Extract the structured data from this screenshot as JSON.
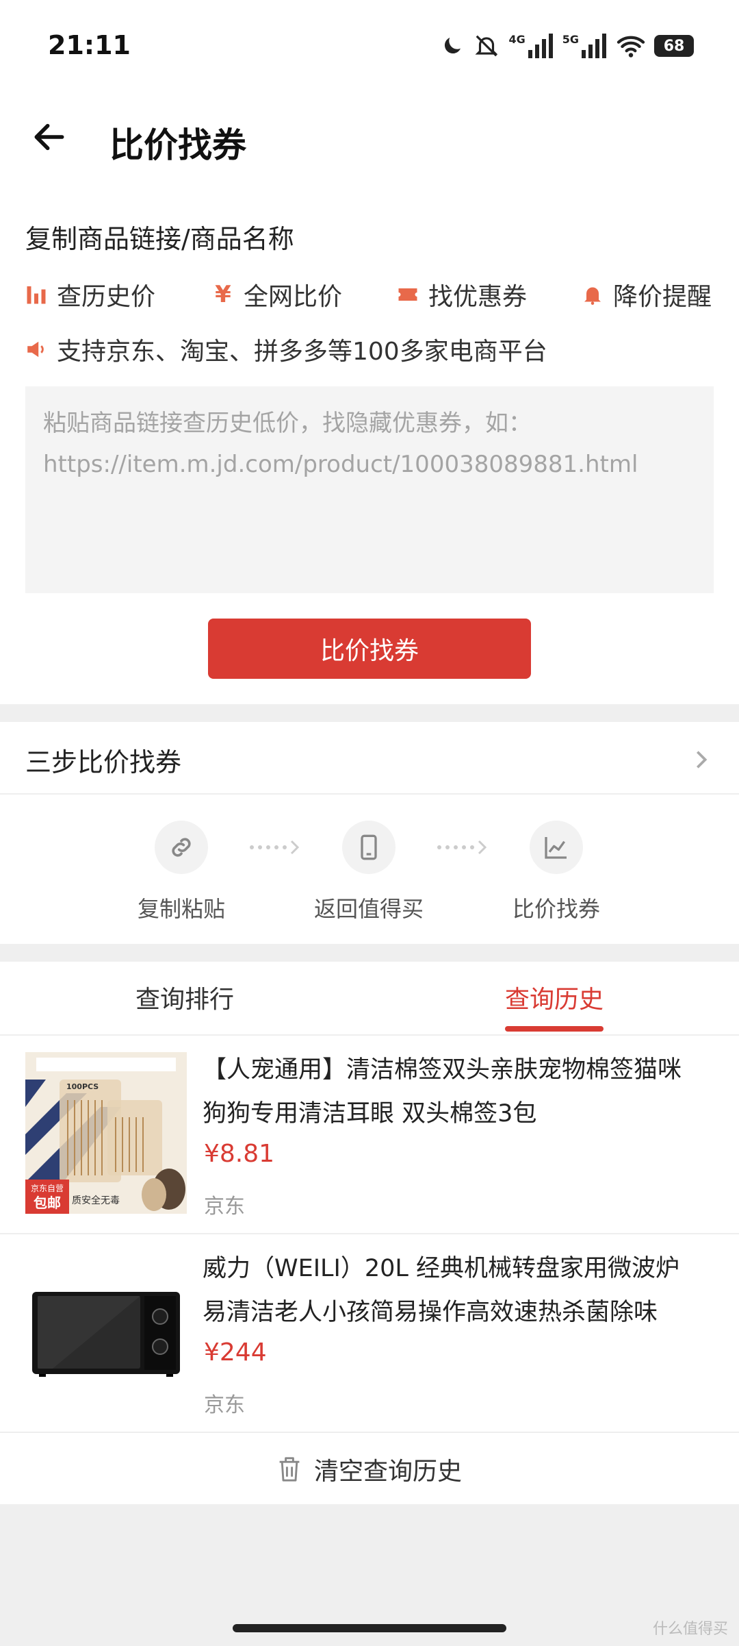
{
  "status_bar": {
    "time": "21:11",
    "battery": "68",
    "net1": "4G",
    "net2": "5G"
  },
  "header": {
    "title": "比价找券",
    "back_icon": "back-arrow-icon"
  },
  "form": {
    "label": "复制商品链接/商品名称",
    "features": [
      {
        "icon": "bar-chart-icon",
        "label": "查历史价"
      },
      {
        "icon": "yen-icon",
        "label": "全网比价"
      },
      {
        "icon": "ticket-icon",
        "label": "找优惠券"
      },
      {
        "icon": "bell-icon",
        "label": "降价提醒"
      }
    ],
    "support_text": "支持京东、淘宝、拼多多等100多家电商平台",
    "placeholder_line1": "粘贴商品链接查历史低价，找隐藏优惠券，如：",
    "placeholder_line2": "https://item.m.jd.com/product/100038089881.html",
    "button_label": "比价找券"
  },
  "steps": {
    "title": "三步比价找券",
    "items": [
      {
        "icon": "link-icon",
        "label": "复制粘贴"
      },
      {
        "icon": "phone-icon",
        "label": "返回值得买"
      },
      {
        "icon": "line-chart-icon",
        "label": "比价找券"
      }
    ]
  },
  "tabs": [
    {
      "label": "查询排行"
    },
    {
      "label": "查询历史"
    }
  ],
  "history": [
    {
      "title_line1": "【人宠通用】清洁棉签双头亲肤宠物棉签猫咪",
      "title_line2": "狗狗专用清洁耳眼 双头棉签3包",
      "price": "¥8.81",
      "platform": "京东",
      "badge_top": "京东自营",
      "badge_bottom": "包邮",
      "thumb_text": "质安全无毒",
      "pack_label": "100PCS"
    },
    {
      "title_line1": "威力（WEILI）20L 经典机械转盘家用微波炉",
      "title_line2": "易清洁老人小孩简易操作高效速热杀菌除味",
      "price": "¥244",
      "platform": "京东"
    }
  ],
  "clear_label": "清空查询历史",
  "watermark": "什么值得买",
  "colors": {
    "accent": "#d93b33",
    "icon_orange": "#e8694a"
  }
}
